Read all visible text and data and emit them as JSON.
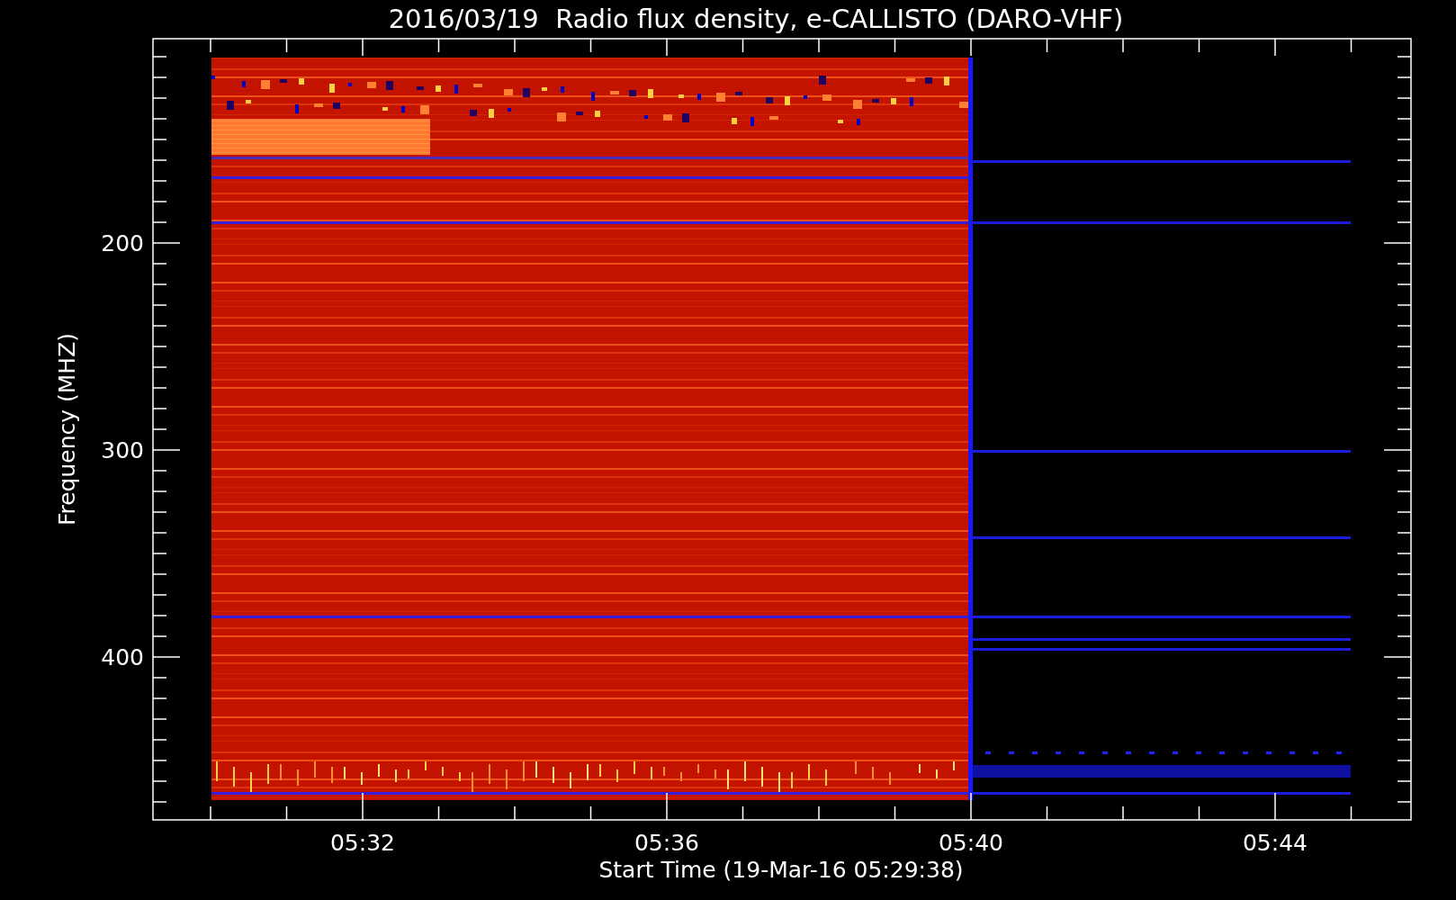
{
  "title": "2016/03/19  Radio flux density, e-CALLISTO (DARO-VHF)",
  "y_axis": {
    "label": "Frequency (MHZ)",
    "ticks": [
      "200",
      "300",
      "400"
    ]
  },
  "x_axis": {
    "label": "Start Time (19-Mar-16 05:29:38)",
    "ticks": [
      "05:32",
      "05:36",
      "05:40",
      "05:44"
    ]
  }
}
